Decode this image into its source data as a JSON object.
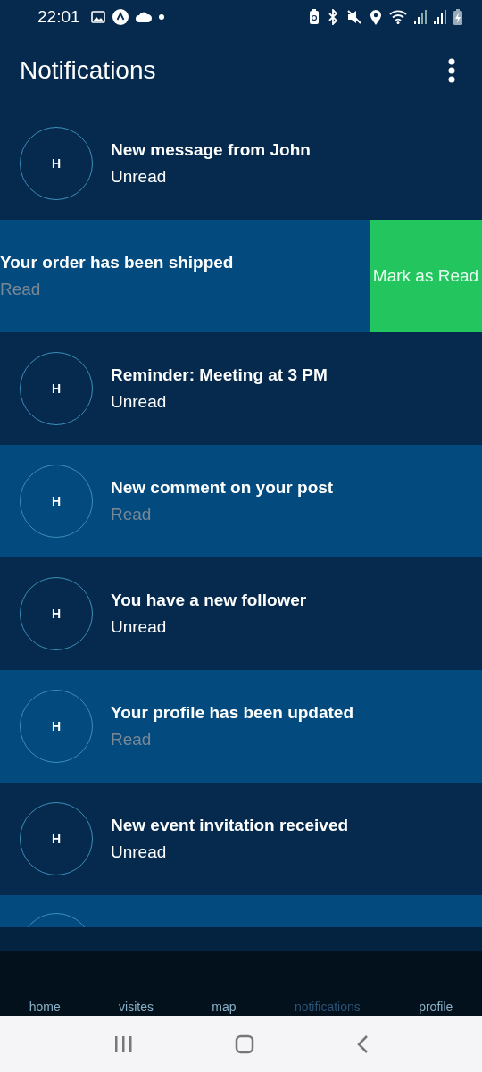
{
  "status_bar": {
    "time": "22:01"
  },
  "header": {
    "title": "Notifications"
  },
  "notifications": [
    {
      "avatar": "H",
      "title": "New message from John",
      "status": "Unread",
      "read": false,
      "swiped": false
    },
    {
      "title": "Your order has been shipped",
      "status": "Read",
      "read": true,
      "swiped": true,
      "action": "Mark as Read"
    },
    {
      "avatar": "H",
      "title": "Reminder: Meeting at 3 PM",
      "status": "Unread",
      "read": false,
      "swiped": false
    },
    {
      "avatar": "H",
      "title": "New comment on your post",
      "status": "Read",
      "read": true,
      "swiped": false
    },
    {
      "avatar": "H",
      "title": "You have a new follower",
      "status": "Unread",
      "read": false,
      "swiped": false
    },
    {
      "avatar": "H",
      "title": "Your profile has been updated",
      "status": "Read",
      "read": true,
      "swiped": false
    },
    {
      "avatar": "H",
      "title": "New event invitation received",
      "status": "Unread",
      "read": false,
      "swiped": false
    },
    {
      "read": true,
      "kind": "partial"
    }
  ],
  "bottom_nav": [
    {
      "label": "home",
      "selected": false
    },
    {
      "label": "visites",
      "selected": false
    },
    {
      "label": "map",
      "selected": false
    },
    {
      "label": "notifications",
      "selected": true
    },
    {
      "label": "profile",
      "selected": false
    }
  ]
}
